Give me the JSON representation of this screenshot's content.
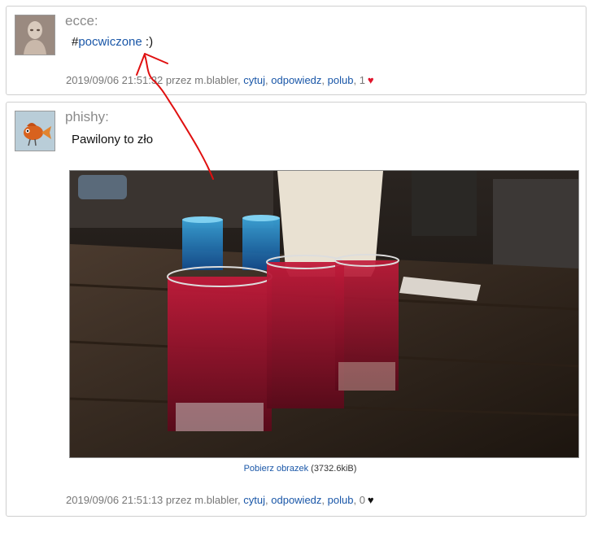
{
  "posts": [
    {
      "author": "ecce:",
      "body_prefix": "#",
      "hashtag": "pocwiczone",
      "body_suffix": " :)",
      "timestamp": "2019/09/06 21:51:32",
      "by_text": " przez ",
      "user": "m.blabler",
      "sep": ", ",
      "quote_label": "cytuj",
      "reply_label": "odpowiedz",
      "like_label": "polub",
      "likes_count": "1",
      "heart_icon": "♥",
      "heart_color": "#e0142b"
    },
    {
      "author": "phishy:",
      "body": "Pawilony to zło",
      "download_label": "Pobierz obrazek",
      "download_size": " (3732.6kiB)",
      "timestamp": "2019/09/06 21:51:13",
      "by_text": " przez ",
      "user": "m.blabler",
      "sep": ", ",
      "quote_label": "cytuj",
      "reply_label": "odpowiedz",
      "like_label": "polub",
      "likes_count": "0",
      "heart_icon": "♥",
      "heart_color": "#111111"
    }
  ],
  "annotation_color": "#e01010"
}
